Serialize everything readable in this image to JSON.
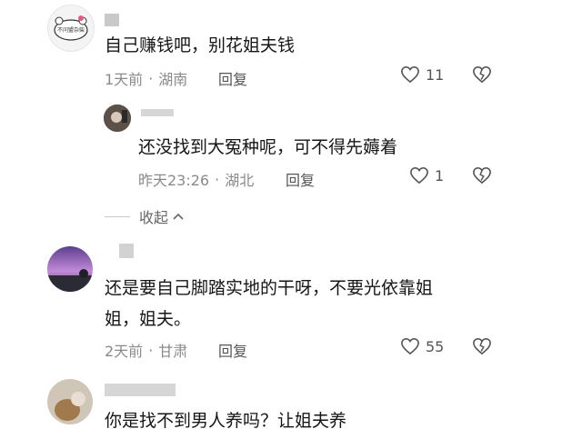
{
  "comments": [
    {
      "text": "自己赚钱吧，别花姐夫钱",
      "time": "1天前",
      "location": "湖南",
      "reply_label": "回复",
      "likes": "11",
      "avatar_text": "不问盟杂柴"
    },
    {
      "text": "还没找到大冤种呢，可不得先薅着",
      "time": "昨天23:26",
      "location": "湖北",
      "reply_label": "回复",
      "likes": "1"
    },
    {
      "text_line1": "还是要自己脚踏实地的干呀，不要光依靠姐",
      "text_line2": "姐，姐夫。",
      "time": "2天前",
      "location": "甘肃",
      "reply_label": "回复",
      "likes": "55"
    },
    {
      "text": "你是找不到男人养吗？让姐夫养"
    }
  ],
  "collapse_label": "收起",
  "colors": {
    "text": "#161616",
    "meta": "#8a8a8a",
    "background": "#ffffff"
  }
}
